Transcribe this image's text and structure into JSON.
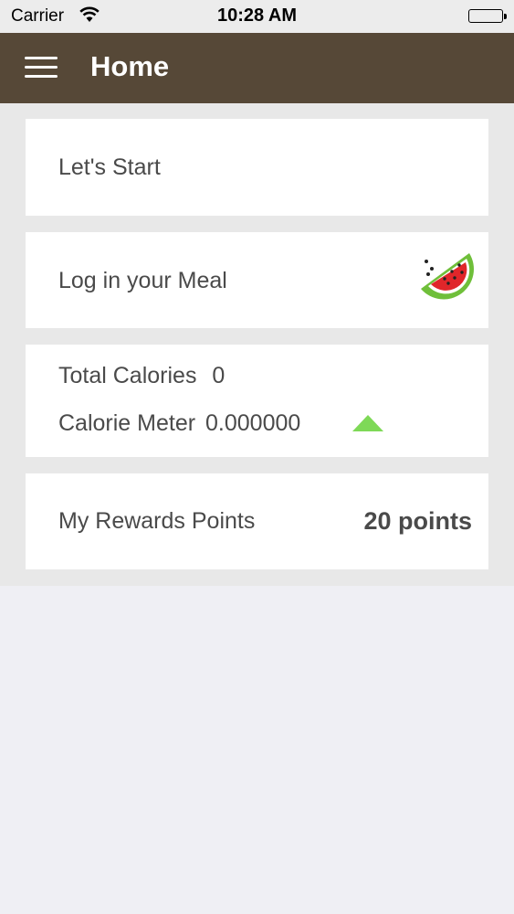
{
  "status_bar": {
    "carrier": "Carrier",
    "time": "10:28 AM"
  },
  "nav_bar": {
    "title": "Home",
    "menu_icon": "hamburger-menu-icon",
    "background": "#564837"
  },
  "cards": {
    "start": {
      "label": "Let's Start"
    },
    "meal": {
      "label": "Log in your Meal",
      "icon": "watermelon-icon"
    },
    "calories": {
      "total_label": "Total Calories",
      "total_value": "0",
      "meter_label": "Calorie Meter",
      "meter_value": "0.000000",
      "indicator_icon": "triangle-up-icon",
      "indicator_color": "#7ed957"
    },
    "rewards": {
      "label": "My Rewards Points",
      "value": "20 points"
    }
  }
}
